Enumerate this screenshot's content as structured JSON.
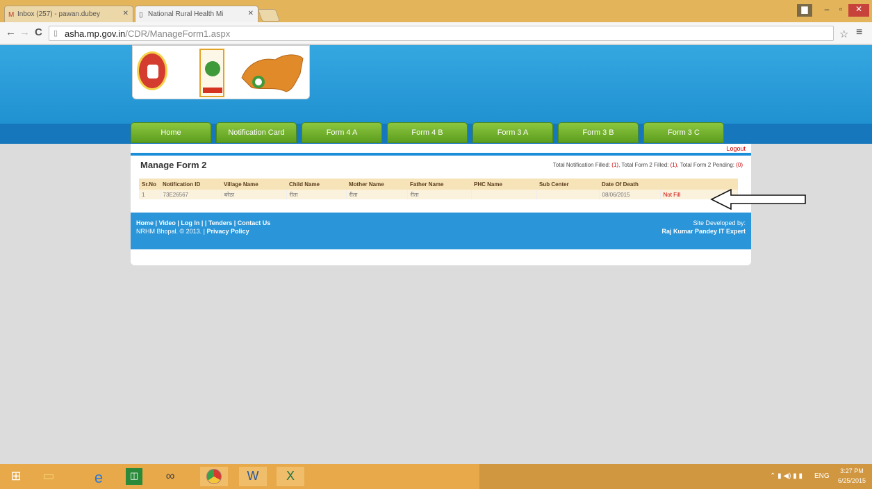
{
  "browser": {
    "tabs": [
      {
        "label": "Inbox (257) - pawan.dubey",
        "icon": "gmail-icon"
      },
      {
        "label": "National Rural Health Mi",
        "icon": "page-icon"
      }
    ],
    "url_host": "asha.mp.gov.in",
    "url_path": "/CDR/ManageForm1.aspx"
  },
  "nav": {
    "tabs": [
      "Home",
      "Notification Card",
      "Form 4 A",
      "Form 4 B",
      "Form 3 A",
      "Form 3 B",
      "Form 3 C"
    ]
  },
  "page": {
    "logout": "Logout",
    "title": "Manage Form 2",
    "totals": {
      "notification_label": "Total Notification Filled:",
      "notification_value": "(1)",
      "form2_filled_label": ", Total Form 2 Filled:",
      "form2_filled_value": "(1)",
      "form2_pending_label": ", Total Form 2 Pending:",
      "form2_pending_value": "(0)"
    },
    "table": {
      "headers": [
        "Sr.No",
        "Notification ID",
        "Village Name",
        "Child Name",
        "Mother Name",
        "Father Name",
        "PHC Name",
        "Sub Center",
        "Date Of Death",
        ""
      ],
      "rows": [
        [
          "1",
          "73E26567",
          "बरेठा",
          "रीता",
          "रीता",
          "रीता",
          "",
          "",
          "08/06/2015",
          "Not Fill"
        ]
      ]
    }
  },
  "footer": {
    "links": "Home | Video | Log In | | Tenders | Contact Us",
    "copyright": "NRHM Bhopal. © 2013. |",
    "privacy": "Privacy Policy",
    "credit": "Site Developed by:",
    "author": "Raj Kumar Pandey IT Expert"
  },
  "taskbar": {
    "lang": "ENG",
    "time": "3:27 PM",
    "date": "6/25/2015"
  }
}
